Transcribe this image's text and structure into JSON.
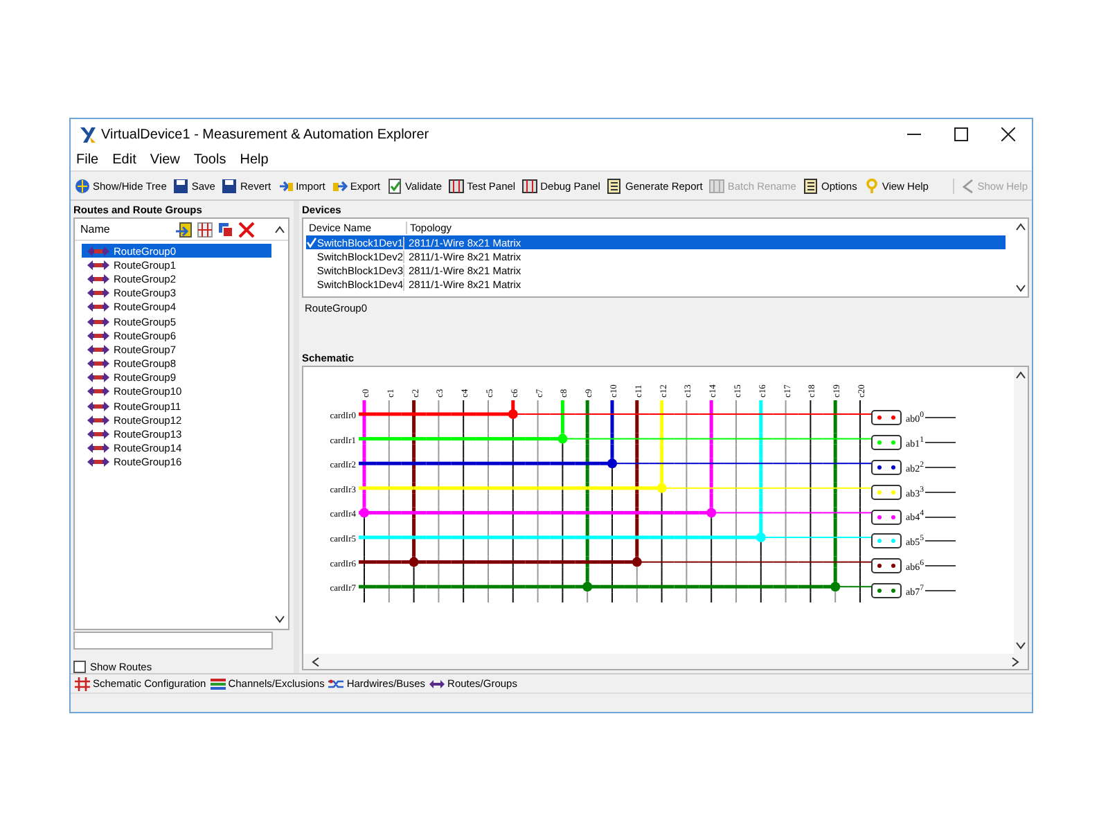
{
  "window": {
    "title": "VirtualDevice1 - Measurement & Automation Explorer"
  },
  "menu": [
    "File",
    "Edit",
    "View",
    "Tools",
    "Help"
  ],
  "toolbar": [
    {
      "label": "Show/Hide Tree",
      "kind": "globe",
      "disabled": false
    },
    {
      "label": "Save",
      "kind": "disk",
      "disabled": false
    },
    {
      "label": "Revert",
      "kind": "disk",
      "disabled": false
    },
    {
      "label": "Import",
      "kind": "import",
      "disabled": false
    },
    {
      "label": "Export",
      "kind": "export",
      "disabled": false
    },
    {
      "label": "Validate",
      "kind": "validate",
      "disabled": false
    },
    {
      "label": "Test Panel",
      "kind": "panel",
      "disabled": false
    },
    {
      "label": "Debug Panel",
      "kind": "panel",
      "disabled": false
    },
    {
      "label": "Generate Report",
      "kind": "report",
      "disabled": false
    },
    {
      "label": "Batch Rename",
      "kind": "panel",
      "disabled": true
    },
    {
      "label": "Options",
      "kind": "report",
      "disabled": false
    },
    {
      "label": "View Help",
      "kind": "help",
      "disabled": false
    }
  ],
  "help_button": {
    "label": "Show Help",
    "disabled": true
  },
  "routes_panel": {
    "title": "Routes and Route Groups",
    "column": "Name",
    "items": [
      {
        "label": "RouteGroup0",
        "selected": true
      },
      {
        "label": "RouteGroup1",
        "selected": false
      },
      {
        "label": "RouteGroup2",
        "selected": false
      },
      {
        "label": "RouteGroup3",
        "selected": false
      },
      {
        "label": "RouteGroup4",
        "selected": false
      },
      {
        "label": "RouteGroup5",
        "selected": false
      },
      {
        "label": "RouteGroup6",
        "selected": false
      },
      {
        "label": "RouteGroup7",
        "selected": false
      },
      {
        "label": "RouteGroup8",
        "selected": false
      },
      {
        "label": "RouteGroup9",
        "selected": false
      },
      {
        "label": "RouteGroup10",
        "selected": false
      },
      {
        "label": "RouteGroup11",
        "selected": false
      },
      {
        "label": "RouteGroup12",
        "selected": false
      },
      {
        "label": "RouteGroup13",
        "selected": false
      },
      {
        "label": "RouteGroup14",
        "selected": false
      },
      {
        "label": "RouteGroup16",
        "selected": false
      }
    ],
    "show_routes": {
      "label": "Show Routes",
      "checked": false
    }
  },
  "devices": {
    "title": "Devices",
    "columns": [
      "Device Name",
      "Topology"
    ],
    "rows": [
      {
        "name": "SwitchBlock1Dev1",
        "topology": "2811/1-Wire 8x21 Matrix",
        "checked": true,
        "selected": true
      },
      {
        "name": "SwitchBlock1Dev2",
        "topology": "2811/1-Wire 8x21 Matrix",
        "checked": false,
        "selected": false
      },
      {
        "name": "SwitchBlock1Dev3",
        "topology": "2811/1-Wire 8x21 Matrix",
        "checked": false,
        "selected": false
      },
      {
        "name": "SwitchBlock1Dev4",
        "topology": "2811/1-Wire 8x21 Matrix",
        "checked": false,
        "selected": false
      }
    ],
    "route_group": "RouteGroup0"
  },
  "schematic": {
    "title": "Schematic",
    "columns": [
      "c0",
      "c1",
      "c2",
      "c3",
      "c4",
      "c5",
      "c6",
      "c7",
      "c8",
      "c9",
      "c10",
      "c11",
      "c12",
      "c13",
      "c14",
      "c15",
      "c16",
      "c17",
      "c18",
      "c19",
      "c20"
    ],
    "rows": [
      {
        "label": "cardIr0",
        "color": "#ff0000",
        "terminal": "ab0$^{0}$",
        "connected": [
          false,
          false,
          false,
          false,
          false,
          false,
          true,
          false,
          false,
          false,
          false,
          false,
          false,
          false,
          false,
          false,
          false,
          false,
          false,
          false,
          false
        ]
      },
      {
        "label": "cardIr1",
        "color": "#00ff00",
        "terminal": "ab1$^{1}$",
        "connected": [
          false,
          false,
          false,
          false,
          false,
          false,
          false,
          false,
          true,
          false,
          false,
          false,
          false,
          false,
          false,
          false,
          false,
          false,
          false,
          false,
          false
        ]
      },
      {
        "label": "cardIr2",
        "color": "#0000cc",
        "terminal": "ab2$^{2}$",
        "connected": [
          false,
          false,
          false,
          false,
          false,
          false,
          false,
          false,
          false,
          false,
          true,
          false,
          false,
          false,
          false,
          false,
          false,
          false,
          false,
          false,
          false
        ]
      },
      {
        "label": "cardIr3",
        "color": "#ffff00",
        "terminal": "ab3$^{3}$",
        "connected": [
          false,
          false,
          false,
          false,
          false,
          false,
          false,
          false,
          false,
          false,
          false,
          false,
          true,
          false,
          false,
          false,
          false,
          false,
          false,
          false,
          false
        ]
      },
      {
        "label": "cardIr4",
        "color": "#ff00ff",
        "terminal": "ab4$^{4}$",
        "connected": [
          true,
          false,
          false,
          false,
          false,
          false,
          false,
          false,
          false,
          false,
          false,
          false,
          false,
          false,
          true,
          false,
          false,
          false,
          false,
          false,
          false
        ]
      },
      {
        "label": "cardIr5",
        "color": "#00ffff",
        "terminal": "ab5$^{5}$",
        "connected": [
          false,
          false,
          false,
          false,
          false,
          false,
          false,
          false,
          false,
          false,
          false,
          false,
          false,
          false,
          false,
          false,
          true,
          false,
          false,
          false,
          false
        ]
      },
      {
        "label": "cardIr6",
        "color": "#800000",
        "terminal": "ab6$^{6}$",
        "connected": [
          false,
          false,
          true,
          false,
          false,
          false,
          false,
          false,
          false,
          false,
          false,
          true,
          false,
          false,
          false,
          false,
          false,
          false,
          false,
          false,
          false
        ]
      },
      {
        "label": "cardIr7",
        "color": "#008000",
        "terminal": "ab7$^{7}$",
        "connected": [
          false,
          false,
          false,
          false,
          false,
          false,
          false,
          false,
          false,
          true,
          false,
          false,
          false,
          false,
          false,
          false,
          false,
          false,
          false,
          true,
          false
        ]
      }
    ]
  },
  "tabs": [
    {
      "label": "Schematic Configuration",
      "kind": "grid"
    },
    {
      "label": "Channels/Exclusions",
      "kind": "channels"
    },
    {
      "label": "Hardwires/Buses",
      "kind": "wires"
    },
    {
      "label": "Routes/Groups",
      "kind": "route"
    }
  ]
}
